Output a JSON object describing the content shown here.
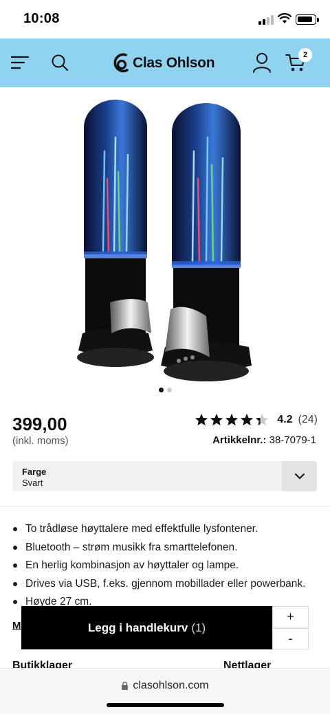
{
  "status_bar": {
    "time": "10:08"
  },
  "header": {
    "logo_text": "Clas Ohlson",
    "cart_count": "2",
    "background": "#8fd3f0"
  },
  "product": {
    "image_alt": "water fountain speakers",
    "carousel_dots": 2,
    "price": "399,00",
    "price_note": "(inkl. moms)",
    "rating_value": "4.2",
    "rating_count": "(24)",
    "rating": 4.2,
    "article_label": "Artikkelnr.:",
    "article_number": "38-7079-1"
  },
  "color_select": {
    "label": "Farge",
    "value": "Svart"
  },
  "bullets": [
    "To trådløse høyttalere med effektfulle lysfontener.",
    "Bluetooth – strøm musikk fra smarttelefonen.",
    "En herlig kombinasjon av høyttaler og lampe.",
    "Drives via USB, f.eks. gjennom mobillader eller powerbank.",
    "Høyde 27 cm."
  ],
  "more_link_peek": "M",
  "cart_bar": {
    "add_label": "Legg i handlekurv",
    "add_count": "(1)",
    "plus": "+",
    "minus": "-"
  },
  "stock": {
    "store": "Butikklager",
    "online": "Nettlager"
  },
  "browser": {
    "url": "clasohlson.com"
  }
}
